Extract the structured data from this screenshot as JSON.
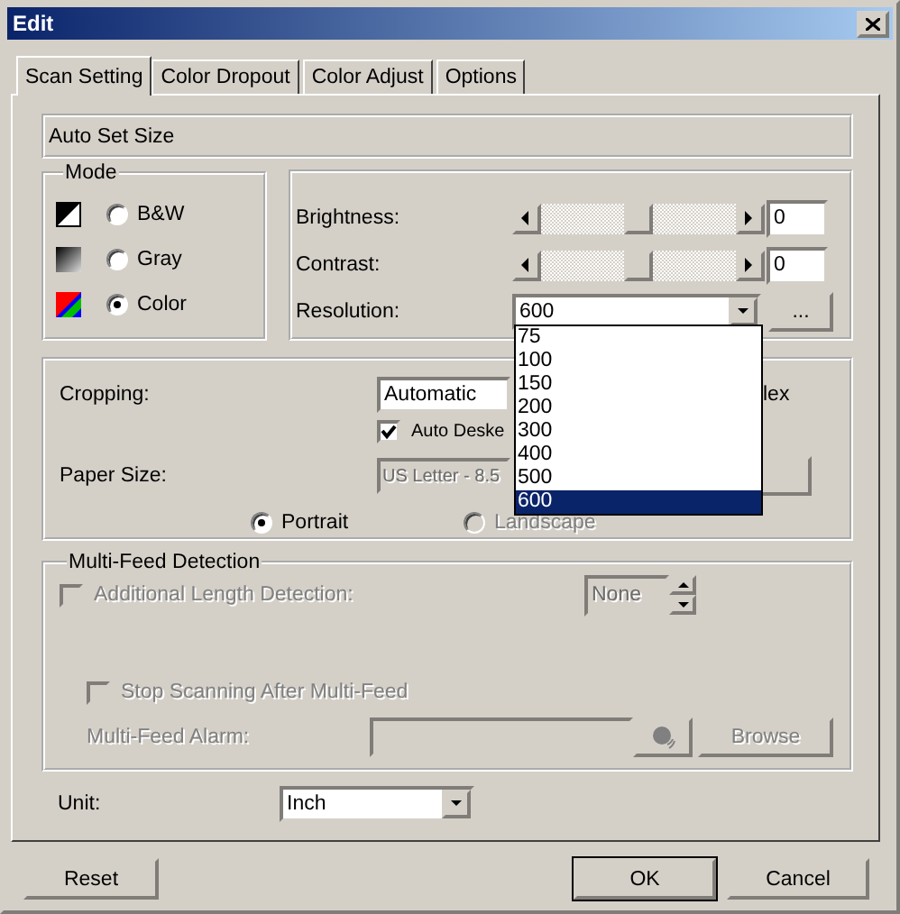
{
  "window": {
    "title": "Edit"
  },
  "tabs": [
    {
      "label": "Scan Setting",
      "selected": true
    },
    {
      "label": "Color Dropout",
      "selected": false
    },
    {
      "label": "Color Adjust",
      "selected": false
    },
    {
      "label": "Options",
      "selected": false
    }
  ],
  "auto_set_size": {
    "value": "Auto Set Size"
  },
  "mode": {
    "title": "Mode",
    "options": [
      {
        "kind": "bw",
        "label": "B&W",
        "selected": false
      },
      {
        "kind": "gray",
        "label": "Gray",
        "selected": false
      },
      {
        "kind": "color",
        "label": "Color",
        "selected": true
      }
    ]
  },
  "adjustments": {
    "sliders": [
      {
        "label": "Brightness:",
        "level": 0.5,
        "value": "0"
      },
      {
        "label": "Contrast:",
        "level": 0.5,
        "value": "0"
      }
    ],
    "resolution": {
      "label": "Resolution:",
      "value": "600",
      "button": "...",
      "options": [
        {
          "label": "75",
          "selected": false
        },
        {
          "label": "100",
          "selected": false
        },
        {
          "label": "150",
          "selected": false
        },
        {
          "label": "200",
          "selected": false
        },
        {
          "label": "300",
          "selected": false
        },
        {
          "label": "400",
          "selected": false
        },
        {
          "label": "500",
          "selected": false
        },
        {
          "label": "600",
          "selected": true
        }
      ]
    }
  },
  "cropping": {
    "label": "Cropping:",
    "value": "Automatic",
    "trailing_text": "lex",
    "auto_deskew": {
      "label": "Auto Deske",
      "checked": true
    },
    "paper_size": {
      "label": "Paper Size:",
      "value": "US Letter - 8.5",
      "disabled": true
    },
    "orientation": [
      {
        "label": "Portrait",
        "selected": true,
        "disabled": false
      },
      {
        "label": "Landscape",
        "selected": false,
        "disabled": true
      }
    ]
  },
  "multi_feed": {
    "title": "Multi-Feed Detection",
    "additional_length": {
      "label": "Additional Length Detection:",
      "checked": false,
      "disabled": true,
      "value": "None"
    },
    "stop_scanning": {
      "label": "Stop Scanning After Multi-Feed",
      "checked": false,
      "disabled": true
    },
    "alarm": {
      "label": "Multi-Feed Alarm:",
      "button": "Browse",
      "disabled": true
    }
  },
  "unit": {
    "label": "Unit:",
    "value": "Inch"
  },
  "buttons": [
    {
      "label": "Reset",
      "default": false
    },
    {
      "label": "OK",
      "default": true
    },
    {
      "label": "Cancel",
      "default": false
    }
  ]
}
